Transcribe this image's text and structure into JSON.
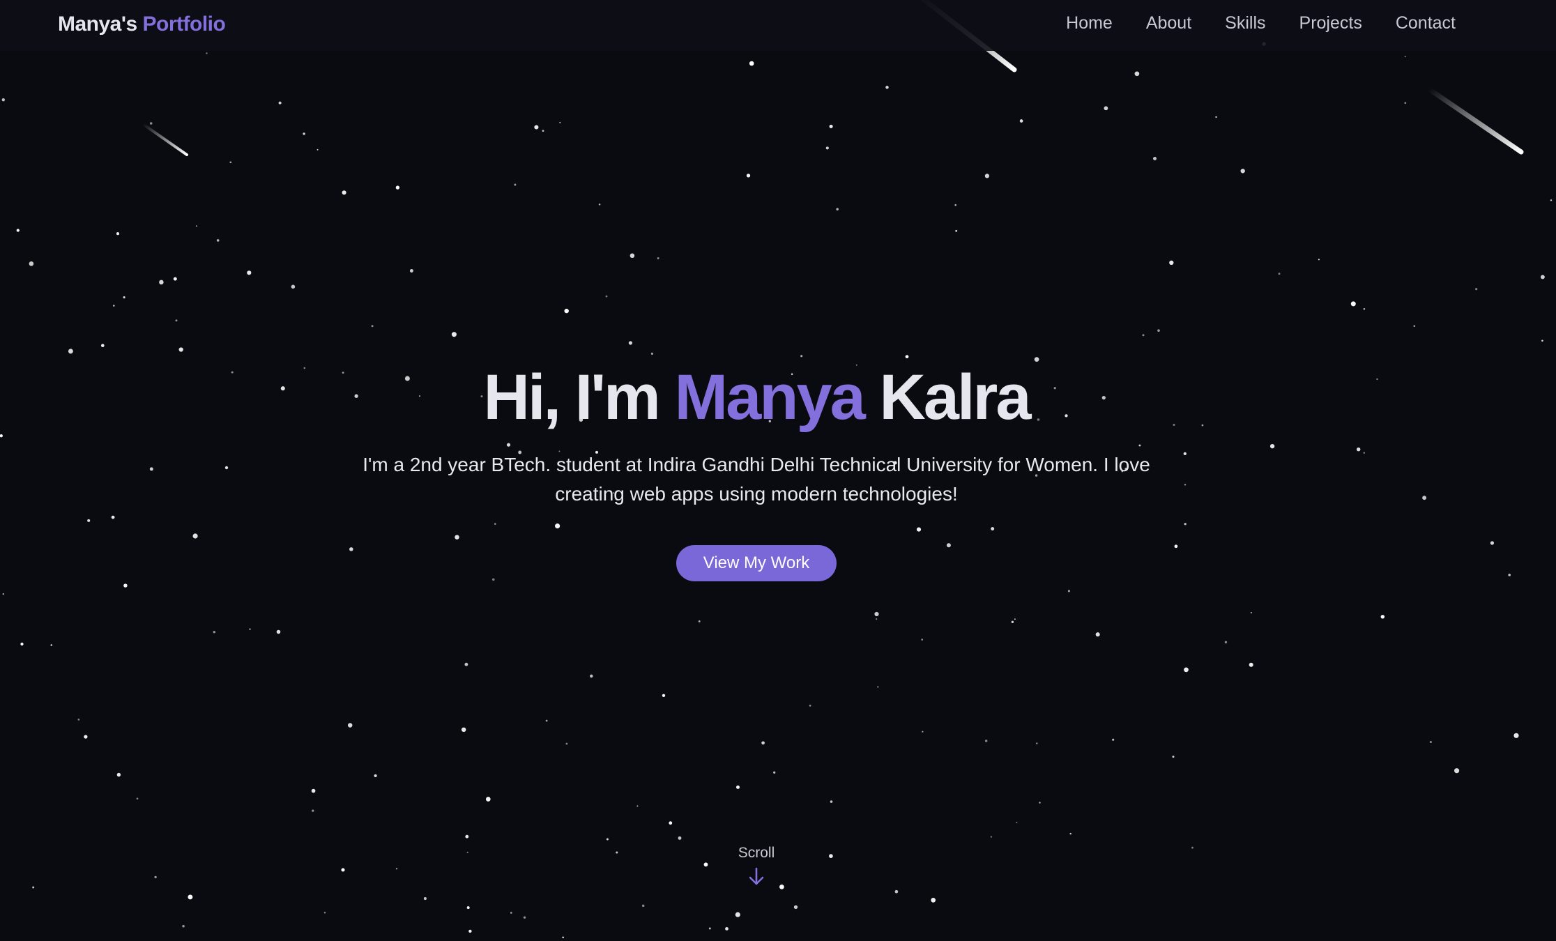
{
  "navbar": {
    "brand": {
      "first": "Manya's",
      "accent": "Portfolio"
    },
    "links": [
      {
        "label": "Home"
      },
      {
        "label": "About"
      },
      {
        "label": "Skills"
      },
      {
        "label": "Projects"
      },
      {
        "label": "Contact"
      }
    ]
  },
  "hero": {
    "greeting": "Hi, I'm",
    "first_name": "Manya",
    "last_name": "Kalra",
    "subtitle": "I'm a 2nd year BTech. student at Indira Gandhi Delhi Technical University for Women. I love creating web apps using modern technologies!",
    "cta_label": "View My Work"
  },
  "scroll": {
    "label": "Scroll",
    "icon": "arrow-down-icon"
  },
  "background": {
    "style": "starry-night-sky",
    "elements": [
      "stars",
      "shooting-stars"
    ]
  },
  "colors": {
    "background": "#0a0b10",
    "accent": "#8470dc",
    "button": "#7a67d8",
    "text": "#e6e7ee",
    "nav_text": "#c7c8d2"
  }
}
